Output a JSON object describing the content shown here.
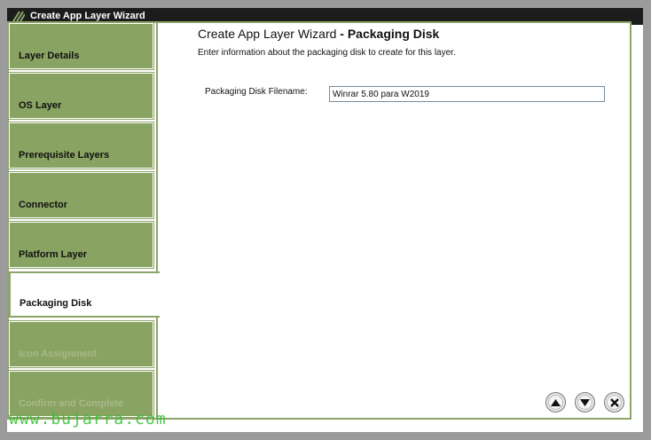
{
  "window": {
    "title": "Create App Layer Wizard",
    "title_icon": "citrix-logo-icon"
  },
  "sidebar": {
    "steps": [
      {
        "label": "Layer Details",
        "state": "done"
      },
      {
        "label": "OS Layer",
        "state": "done"
      },
      {
        "label": "Prerequisite Layers",
        "state": "done"
      },
      {
        "label": "Connector",
        "state": "done"
      },
      {
        "label": "Platform Layer",
        "state": "done"
      },
      {
        "label": "Packaging Disk",
        "state": "active"
      },
      {
        "label": "Icon Assignment",
        "state": "disabled"
      },
      {
        "label": "Confirm and Complete",
        "state": "disabled"
      }
    ]
  },
  "main": {
    "heading_prefix": "Create App Layer Wizard",
    "heading_suffix": " - Packaging Disk",
    "subheading": "Enter information about the packaging disk to create for this layer.",
    "field_label": "Packaging Disk Filename:",
    "field_value": "Winrar 5.80 para W2019"
  },
  "nav": {
    "up_icon": "arrow-up-icon",
    "down_icon": "arrow-down-icon",
    "close_icon": "close-icon"
  },
  "watermark": "www.bujarra.com",
  "colors": {
    "accent_green": "#88a362",
    "border_green": "#8ea56a",
    "titlebar": "#1c1c1c",
    "background": "#9b9b9b"
  }
}
